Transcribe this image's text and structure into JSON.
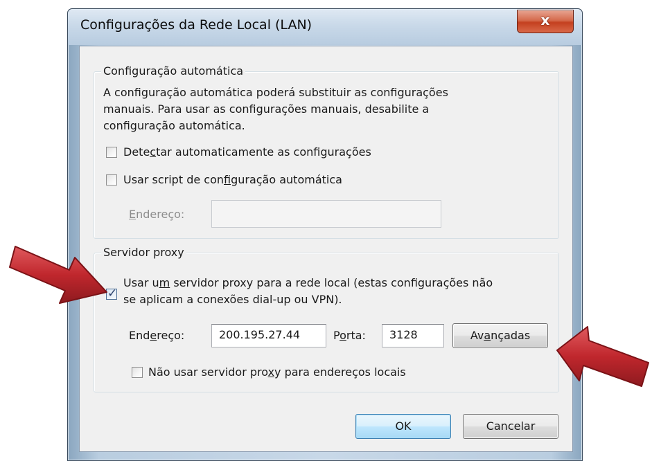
{
  "window": {
    "title": "Configurações da Rede Local (LAN)",
    "close_label": "x"
  },
  "auto_config": {
    "group_title": "Configuração automática",
    "description_line1": "A configuração automática poderá substituir as configurações",
    "description_line2": "manuais. Para usar as configurações manuais, desabilite a",
    "description_line3": "configuração automática.",
    "detect": {
      "label_pre": "Dete",
      "label_accel": "c",
      "label_post": "tar automaticamente as configurações",
      "checked": false
    },
    "script": {
      "label_pre": "Usar script de con",
      "label_accel": "f",
      "label_post": "iguração automática",
      "checked": false
    },
    "address": {
      "label_pre": "",
      "label_accel": "E",
      "label_post": "ndereço:",
      "value": ""
    }
  },
  "proxy": {
    "group_title": "Servidor proxy",
    "use_proxy": {
      "label_line1_pre": "Usar u",
      "label_line1_accel": "m",
      "label_line1_post": " servidor proxy para a rede local (estas configurações não",
      "label_line2": "se aplicam a conexões dial-up ou VPN).",
      "checked": true
    },
    "address": {
      "label_pre": "End",
      "label_accel": "e",
      "label_post": "reço:",
      "value": "200.195.27.44"
    },
    "port": {
      "label_pre": "P",
      "label_accel": "o",
      "label_post": "rta:",
      "value": "3128"
    },
    "advanced": {
      "label_pre": "Av",
      "label_accel": "a",
      "label_post": "nçadas"
    },
    "bypass_local": {
      "label_pre": "Não usar servidor pro",
      "label_accel": "x",
      "label_post": "y para endereços locais",
      "checked": false
    }
  },
  "buttons": {
    "ok_label": "OK",
    "cancel_label": "Cancelar"
  },
  "colors": {
    "arrow_fill": "#c0272d",
    "arrow_stroke": "#7a1216",
    "close_button": "#c4401f"
  }
}
